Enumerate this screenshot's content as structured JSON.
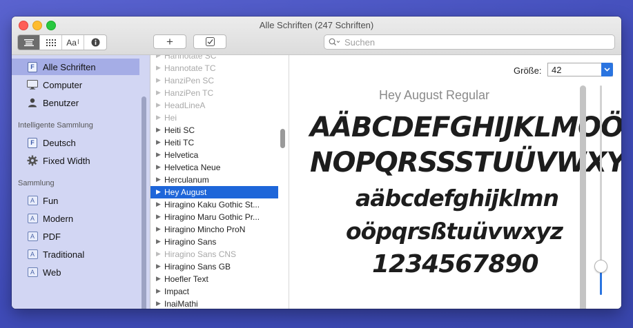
{
  "window": {
    "title": "Alle Schriften (247 Schriften)"
  },
  "toolbar": {
    "view_icons": [
      "list-view-icon",
      "grid-view-icon",
      "sample-view-icon",
      "info-icon"
    ],
    "sample_label": "Aa",
    "add_label": "+",
    "search_placeholder": "Suchen"
  },
  "sidebar": {
    "library": [
      {
        "label": "Alle Schriften",
        "icon": "font-file-icon",
        "active": true
      },
      {
        "label": "Computer",
        "icon": "computer-icon"
      },
      {
        "label": "Benutzer",
        "icon": "user-icon"
      }
    ],
    "smart_header": "Intelligente Sammlung",
    "smart": [
      {
        "label": "Deutsch",
        "icon": "font-file-icon"
      },
      {
        "label": "Fixed Width",
        "icon": "gear-icon"
      }
    ],
    "collection_header": "Sammlung",
    "collections": [
      {
        "label": "Fun",
        "icon": "collection-icon"
      },
      {
        "label": "Modern",
        "icon": "collection-icon"
      },
      {
        "label": "PDF",
        "icon": "collection-icon"
      },
      {
        "label": "Traditional",
        "icon": "collection-icon"
      },
      {
        "label": "Web",
        "icon": "collection-icon"
      }
    ],
    "add_label": "+"
  },
  "font_list": [
    {
      "name": "Hannotate SC",
      "dim": true
    },
    {
      "name": "Hannotate TC",
      "dim": true
    },
    {
      "name": "HanziPen SC",
      "dim": true
    },
    {
      "name": "HanziPen TC",
      "dim": true
    },
    {
      "name": "HeadLineA",
      "dim": true
    },
    {
      "name": "Hei",
      "dim": true
    },
    {
      "name": "Heiti SC"
    },
    {
      "name": "Heiti TC"
    },
    {
      "name": "Helvetica"
    },
    {
      "name": "Helvetica Neue"
    },
    {
      "name": "Herculanum"
    },
    {
      "name": "Hey August",
      "selected": true
    },
    {
      "name": "Hiragino Kaku Gothic St..."
    },
    {
      "name": "Hiragino Maru Gothic Pr..."
    },
    {
      "name": "Hiragino Mincho ProN"
    },
    {
      "name": "Hiragino Sans"
    },
    {
      "name": "Hiragino Sans CNS",
      "dim": true
    },
    {
      "name": "Hiragino Sans GB"
    },
    {
      "name": "Hoefler Text"
    },
    {
      "name": "Impact"
    },
    {
      "name": "InaiMathi"
    }
  ],
  "preview": {
    "size_label": "Größe:",
    "size_value": "42",
    "font_title": "Hey August Regular",
    "lines": [
      "AÄBCDEFGHIJKLMOÖ",
      "NOPQRSSSTUÜVWXYZ",
      "aäbcdefghijklmn",
      "oöpqrsßtuüvwxyz",
      "1234567890"
    ],
    "slider_level_percent": 14
  },
  "colors": {
    "accent": "#1e66d9",
    "sidebar_bg": "#d2d6f3",
    "sidebar_selected": "#a5ade6"
  }
}
